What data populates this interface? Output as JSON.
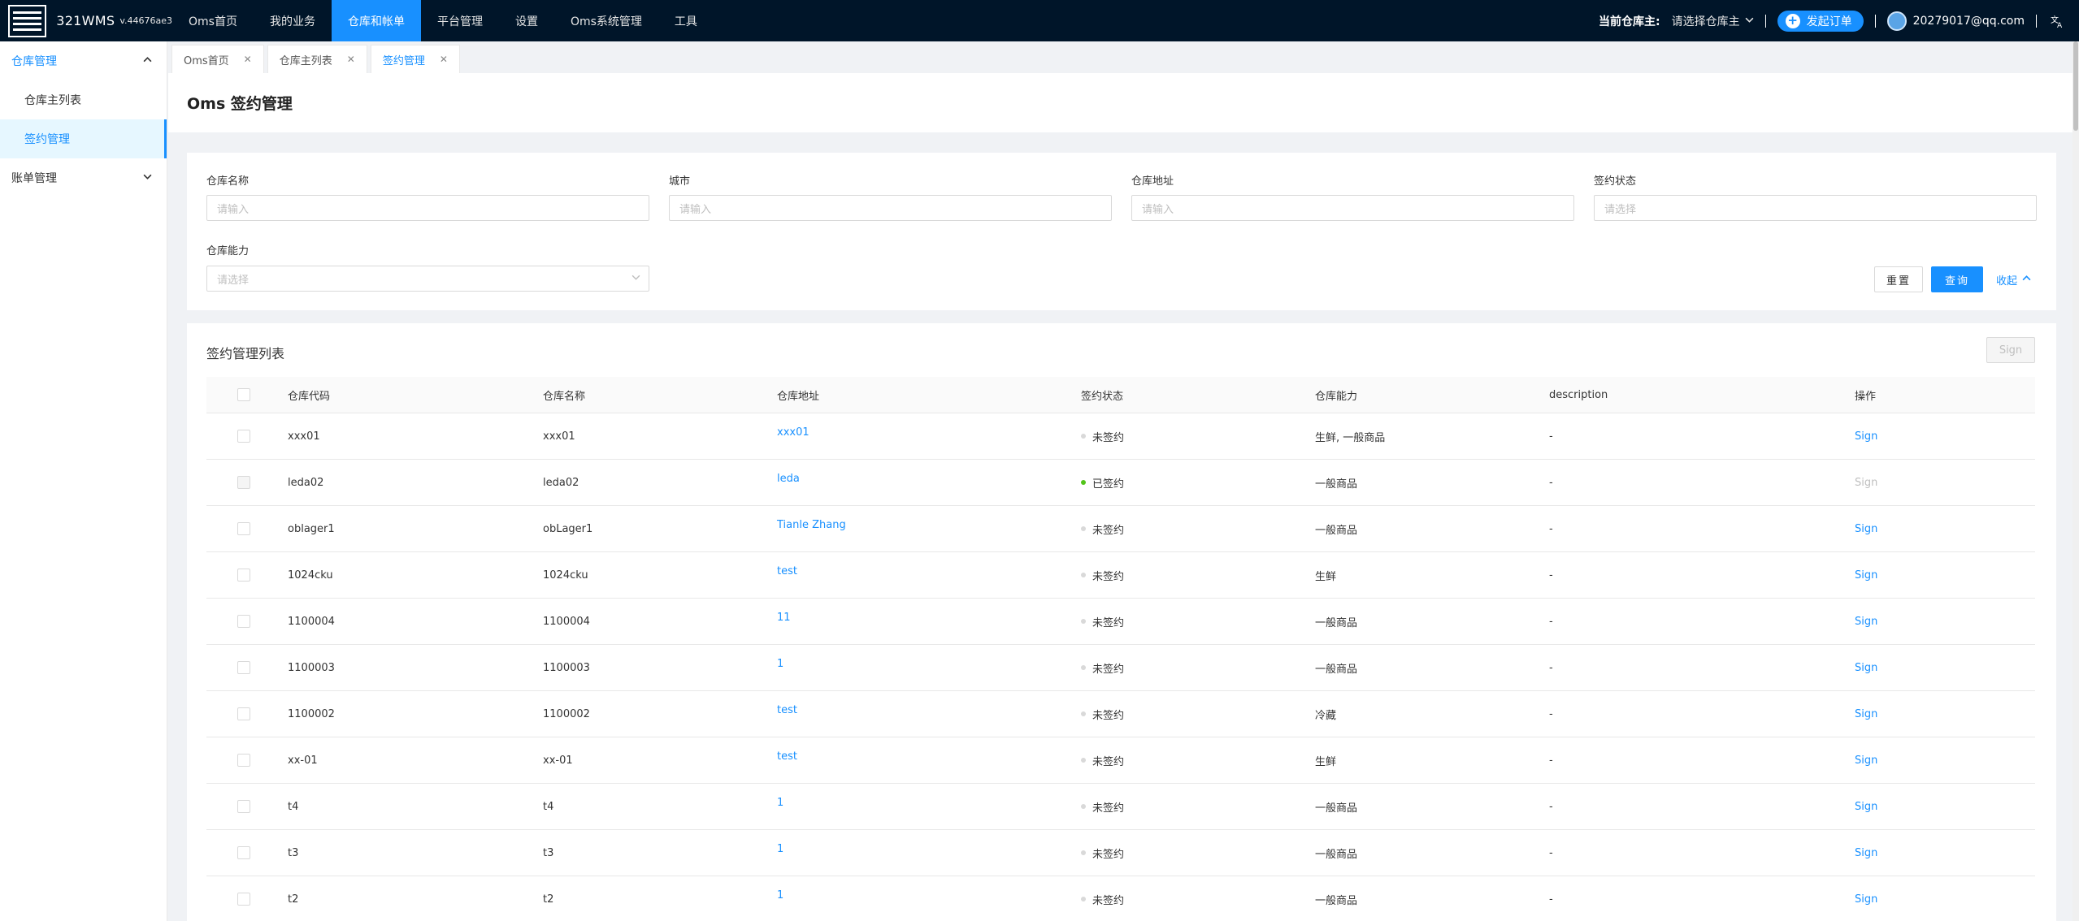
{
  "app": {
    "name": "321WMS",
    "version": "v.44676ae3"
  },
  "nav": [
    {
      "label": "Oms首页",
      "active": false
    },
    {
      "label": "我的业务",
      "active": false
    },
    {
      "label": "仓库和帐单",
      "active": true
    },
    {
      "label": "平台管理",
      "active": false
    },
    {
      "label": "设置",
      "active": false
    },
    {
      "label": "Oms系统管理",
      "active": false
    },
    {
      "label": "工具",
      "active": false
    }
  ],
  "topright": {
    "warehouse_label": "当前仓库主:",
    "warehouse_select": "请选择仓库主",
    "order_button": "发起订单",
    "email": "20279017@qq.com",
    "lang_icon": "translate-icon"
  },
  "sidebar": {
    "groups": [
      {
        "label": "仓库管理",
        "open": true,
        "items": [
          {
            "label": "仓库主列表",
            "active": false
          },
          {
            "label": "签约管理",
            "active": true
          }
        ]
      },
      {
        "label": "账单管理",
        "open": false,
        "items": []
      }
    ]
  },
  "tabs": [
    {
      "label": "Oms首页",
      "active": false
    },
    {
      "label": "仓库主列表",
      "active": false
    },
    {
      "label": "签约管理",
      "active": true
    }
  ],
  "page": {
    "title": "Oms 签约管理"
  },
  "filter": {
    "warehouse_name": {
      "label": "仓库名称",
      "placeholder": "请输入"
    },
    "city": {
      "label": "城市",
      "placeholder": "请输入"
    },
    "warehouse_address": {
      "label": "仓库地址",
      "placeholder": "请输入"
    },
    "sign_status": {
      "label": "签约状态",
      "placeholder": "请选择"
    },
    "capability": {
      "label": "仓库能力",
      "placeholder": "请选择"
    },
    "reset": "重置",
    "query": "查询",
    "collapse": "收起"
  },
  "table": {
    "title": "签约管理列表",
    "sign_button": "Sign",
    "columns": [
      "仓库代码",
      "仓库名称",
      "仓库地址",
      "签约状态",
      "仓库能力",
      "description",
      "操作"
    ],
    "rows": [
      {
        "code": "xxx01",
        "name": "xxx01",
        "address": "xxx01",
        "status": "未签约",
        "signed": false,
        "capability": "生鲜, 一般商品",
        "description": "-",
        "op": "Sign"
      },
      {
        "code": "leda02",
        "name": "leda02",
        "address": "leda",
        "status": "已签约",
        "signed": true,
        "capability": "一般商品",
        "description": "-",
        "op": "Sign"
      },
      {
        "code": "oblager1",
        "name": "obLager1",
        "address": "Tianle Zhang",
        "status": "未签约",
        "signed": false,
        "capability": "一般商品",
        "description": "-",
        "op": "Sign"
      },
      {
        "code": "1024cku",
        "name": "1024cku",
        "address": "test",
        "status": "未签约",
        "signed": false,
        "capability": "生鲜",
        "description": "-",
        "op": "Sign"
      },
      {
        "code": "1100004",
        "name": "1100004",
        "address": "11",
        "status": "未签约",
        "signed": false,
        "capability": "一般商品",
        "description": "-",
        "op": "Sign"
      },
      {
        "code": "1100003",
        "name": "1100003",
        "address": "1",
        "status": "未签约",
        "signed": false,
        "capability": "一般商品",
        "description": "-",
        "op": "Sign"
      },
      {
        "code": "1100002",
        "name": "1100002",
        "address": "test",
        "status": "未签约",
        "signed": false,
        "capability": "冷藏",
        "description": "-",
        "op": "Sign"
      },
      {
        "code": "xx-01",
        "name": "xx-01",
        "address": "test",
        "status": "未签约",
        "signed": false,
        "capability": "生鲜",
        "description": "-",
        "op": "Sign"
      },
      {
        "code": "t4",
        "name": "t4",
        "address": "1",
        "status": "未签约",
        "signed": false,
        "capability": "一般商品",
        "description": "-",
        "op": "Sign"
      },
      {
        "code": "t3",
        "name": "t3",
        "address": "1",
        "status": "未签约",
        "signed": false,
        "capability": "一般商品",
        "description": "-",
        "op": "Sign"
      },
      {
        "code": "t2",
        "name": "t2",
        "address": "1",
        "status": "未签约",
        "signed": false,
        "capability": "一般商品",
        "description": "-",
        "op": "Sign"
      }
    ]
  },
  "colors": {
    "nav_bg": "#001529",
    "accent": "#1890ff",
    "signed_dot": "#52c41a",
    "unsigned_dot": "#d9d9d9"
  }
}
